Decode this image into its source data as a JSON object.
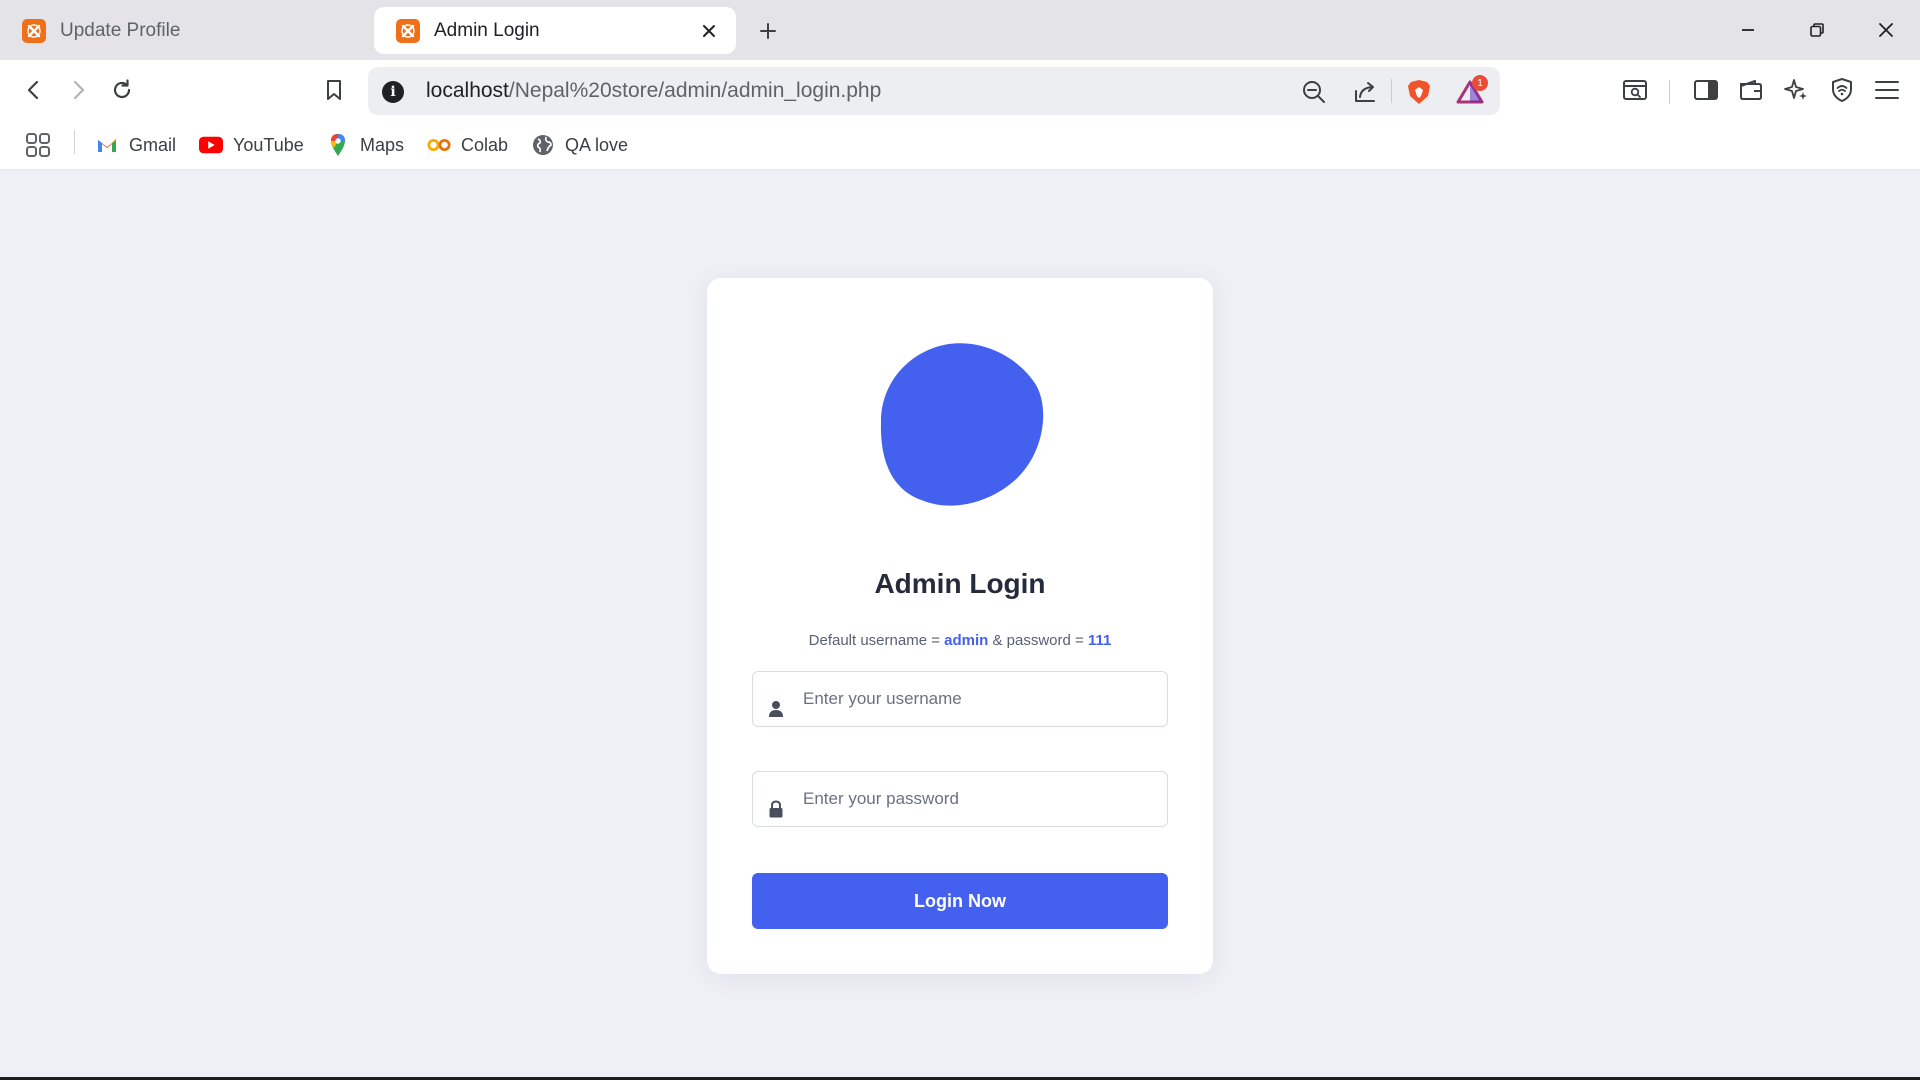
{
  "tabs": [
    {
      "title": "Update Profile",
      "active": false
    },
    {
      "title": "Admin Login",
      "active": true
    }
  ],
  "address_bar": {
    "host": "localhost",
    "path": "/Nepal%20store/admin/admin_login.php",
    "notification_count": "1"
  },
  "bookmarks": [
    {
      "label": "Gmail",
      "icon": "gmail-icon"
    },
    {
      "label": "YouTube",
      "icon": "youtube-icon"
    },
    {
      "label": "Maps",
      "icon": "maps-icon"
    },
    {
      "label": "Colab",
      "icon": "colab-icon"
    },
    {
      "label": "QA love",
      "icon": "globe-icon"
    }
  ],
  "login": {
    "title": "Admin Login",
    "hint_prefix": "Default username = ",
    "hint_username": "admin",
    "hint_mid": " & password = ",
    "hint_password": "111",
    "username_placeholder": "Enter your username",
    "password_placeholder": "Enter your password",
    "button_label": "Login Now"
  },
  "colors": {
    "accent": "#4361ee",
    "favicon": "#f0701a",
    "page_background": "#eef0f5"
  }
}
